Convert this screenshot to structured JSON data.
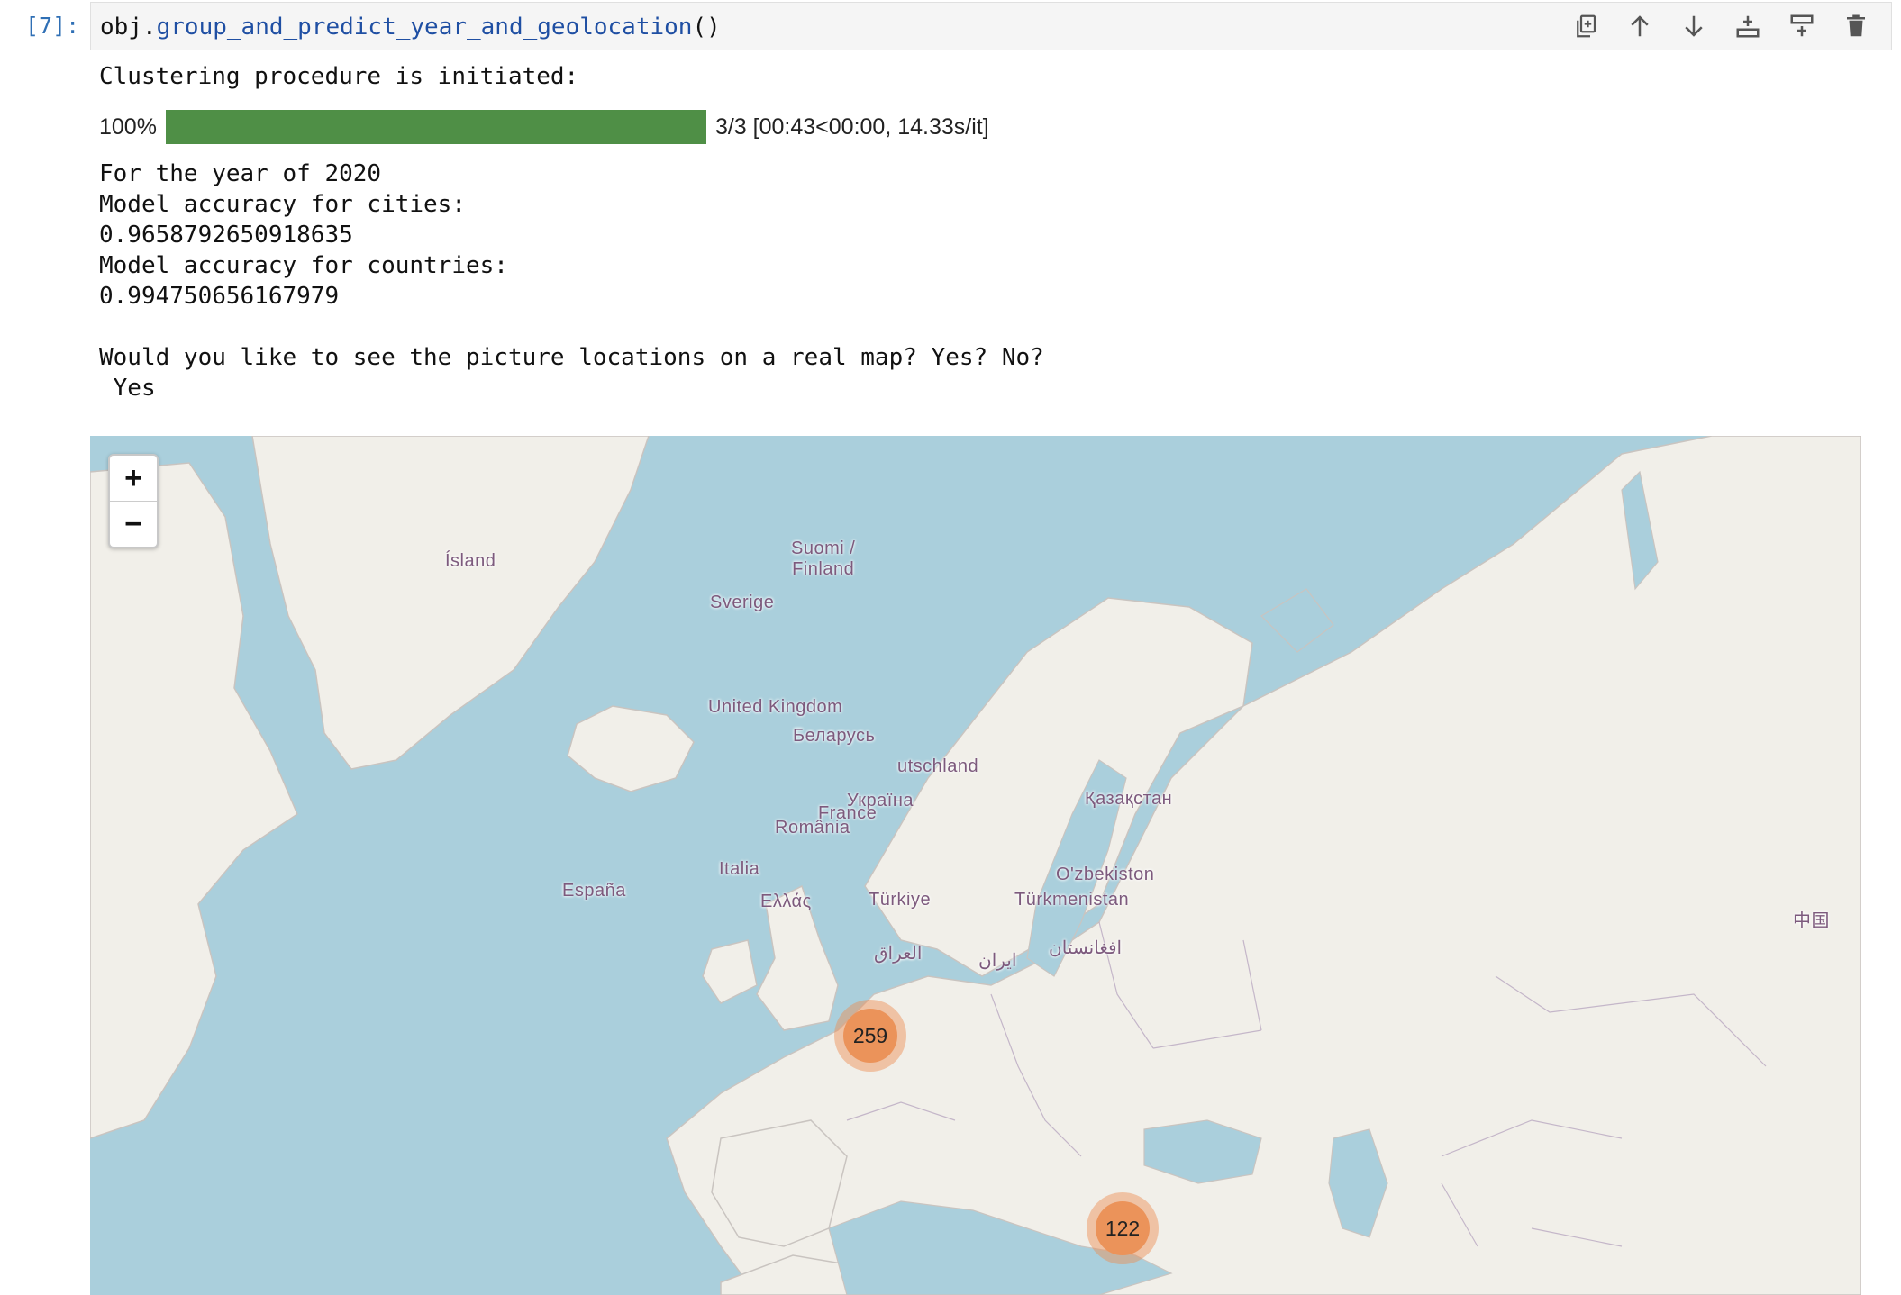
{
  "cell": {
    "prompt": "[7]:",
    "code_object": "obj",
    "code_dot": ".",
    "code_method": "group_and_predict_year_and_geolocation",
    "code_parens": "()"
  },
  "toolbar_icons": [
    "duplicate-icon",
    "move-up-icon",
    "move-down-icon",
    "insert-below-icon",
    "insert-above-icon",
    "delete-icon"
  ],
  "output": {
    "line1": "Clustering procedure is initiated:",
    "progress": {
      "percent_label": "100%",
      "fraction": 1.0,
      "status": "3/3 [00:43<00:00, 14.33s/it]",
      "color": "#4f8f46"
    },
    "line_year": "For the year of 2020",
    "line_cities_label": "Model accuracy for cities:",
    "cities_accuracy": "0.9658792650918635",
    "line_countries_label": "Model accuracy for countries:",
    "countries_accuracy": "0.994750656167979",
    "question": "Would you like to see the picture locations on a real map? Yes? No?",
    "answer": " Yes"
  },
  "map": {
    "zoom_in": "+",
    "zoom_out": "−",
    "labels": {
      "island": "Ísland",
      "finland": "Suomi /\nFinland",
      "sverige": "Sverige",
      "uk": "United Kingdom",
      "belarus": "Беларусь",
      "deutschland": "utschland",
      "ukraina": "Україна",
      "kazakhstan": "Қазақстан",
      "france": "France",
      "romania": "România",
      "uzbekistan": "O'zbekiston",
      "espana": "España",
      "italia": "Italia",
      "turkmenistan": "Türkmenistan",
      "turkiye": "Türkiye",
      "ellas": "Ελλάς",
      "china": "中国",
      "iraq": "العراق",
      "iran": "ایران",
      "afghanistan": "افغانستان"
    },
    "clusters": [
      {
        "count": "259"
      },
      {
        "count": "122"
      }
    ]
  }
}
